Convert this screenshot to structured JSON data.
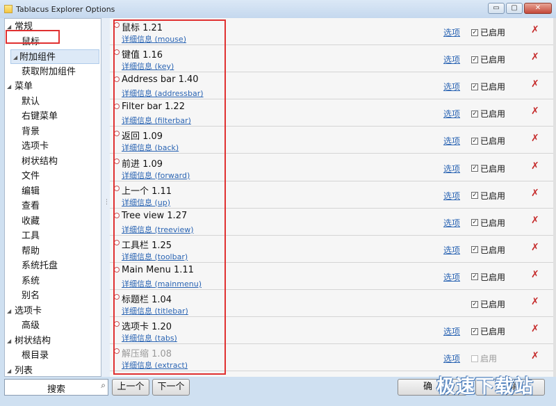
{
  "window": {
    "title": "Tablacus Explorer Options",
    "buttons": {
      "minimize": "▭",
      "maximize": "▢",
      "close": "✕"
    }
  },
  "tree": {
    "items": [
      {
        "label": "常规",
        "level": 0,
        "expanded": true
      },
      {
        "label": "鼠标",
        "level": 1
      },
      {
        "label": "附加组件",
        "level": 0,
        "selected": true
      },
      {
        "label": "获取附加组件",
        "level": 1
      },
      {
        "label": "菜单",
        "level": 0,
        "expanded": true
      },
      {
        "label": "默认",
        "level": 1
      },
      {
        "label": "右键菜单",
        "level": 1
      },
      {
        "label": "背景",
        "level": 1
      },
      {
        "label": "选项卡",
        "level": 1
      },
      {
        "label": "树状结构",
        "level": 1
      },
      {
        "label": "文件",
        "level": 1
      },
      {
        "label": "编辑",
        "level": 1
      },
      {
        "label": "查看",
        "level": 1
      },
      {
        "label": "收藏",
        "level": 1
      },
      {
        "label": "工具",
        "level": 1
      },
      {
        "label": "帮助",
        "level": 1
      },
      {
        "label": "系统托盘",
        "level": 1
      },
      {
        "label": "系统",
        "level": 1
      },
      {
        "label": "别名",
        "level": 1
      },
      {
        "label": "选项卡",
        "level": 0,
        "expanded": true
      },
      {
        "label": "高级",
        "level": 1
      },
      {
        "label": "树状结构",
        "level": 0,
        "expanded": true
      },
      {
        "label": "根目录",
        "level": 1
      },
      {
        "label": "列表",
        "level": 0,
        "expanded": true
      }
    ]
  },
  "addons": {
    "options_label": "选项",
    "enabled_label": "已启用",
    "enable_label": "启用",
    "rows": [
      {
        "name": "鼠标 1.21",
        "details": "详细信息 (mouse)",
        "has_options": true,
        "enabled": true
      },
      {
        "name": "键值 1.16",
        "details": "详细信息 (key)",
        "has_options": true,
        "enabled": true
      },
      {
        "name": "Address bar 1.40",
        "details": "详细信息 (addressbar)",
        "has_options": true,
        "enabled": true
      },
      {
        "name": "Filter bar 1.22",
        "details": "详细信息 (filterbar)",
        "has_options": true,
        "enabled": true
      },
      {
        "name": "返回 1.09",
        "details": "详细信息 (back)",
        "has_options": true,
        "enabled": true
      },
      {
        "name": "前进 1.09",
        "details": "详细信息 (forward)",
        "has_options": true,
        "enabled": true
      },
      {
        "name": "上一个 1.11",
        "details": "详细信息 (up)",
        "has_options": true,
        "enabled": true
      },
      {
        "name": "Tree view 1.27",
        "details": "详细信息 (treeview)",
        "has_options": true,
        "enabled": true
      },
      {
        "name": "工具栏 1.25",
        "details": "详细信息 (toolbar)",
        "has_options": true,
        "enabled": true
      },
      {
        "name": "Main Menu 1.11",
        "details": "详细信息 (mainmenu)",
        "has_options": true,
        "enabled": true
      },
      {
        "name": "标题栏 1.04",
        "details": "详细信息 (titlebar)",
        "has_options": false,
        "enabled": true
      },
      {
        "name": "选项卡 1.20",
        "details": "详细信息 (tabs)",
        "has_options": true,
        "enabled": true
      },
      {
        "name": "解压缩 1.08",
        "details": "详细信息 (extract)",
        "has_options": true,
        "enabled": false
      }
    ]
  },
  "bottom": {
    "search_label": "搜索",
    "up_button": "上一个",
    "down_button": "下一个",
    "ok_button": "确",
    "cancel_button": "取消"
  },
  "watermark": "极速下载站",
  "icons": {
    "search": "search-icon",
    "remove": "remove-icon",
    "arrow_expanded": "◢"
  }
}
